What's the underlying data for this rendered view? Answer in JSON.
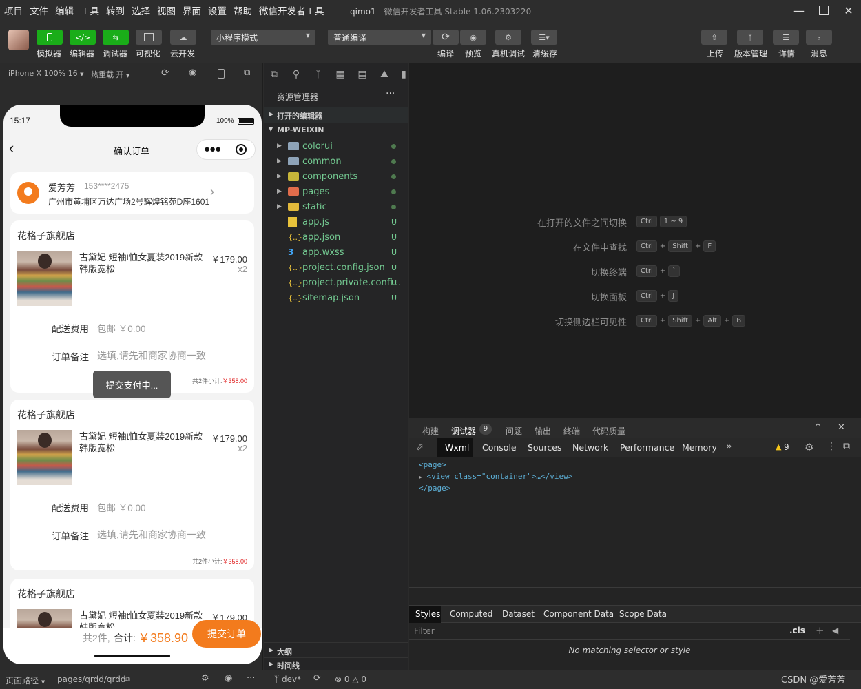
{
  "menubar": {
    "items": [
      "项目",
      "文件",
      "编辑",
      "工具",
      "转到",
      "选择",
      "视图",
      "界面",
      "设置",
      "帮助",
      "微信开发者工具"
    ],
    "app_title": "qimo1",
    "app_subtitle": " - 微信开发者工具 Stable 1.06.2303220"
  },
  "toolbar": {
    "left": [
      {
        "label": "模拟器",
        "icon": "phone-icon",
        "style": "green"
      },
      {
        "label": "编辑器",
        "icon": "code-icon",
        "style": "green"
      },
      {
        "label": "调试器",
        "icon": "swap-icon",
        "style": "green"
      },
      {
        "label": "可视化",
        "icon": "layout-icon",
        "style": "gray"
      },
      {
        "label": "云开发",
        "icon": "cloud-icon",
        "style": "gray"
      }
    ],
    "mode_select": "小程序模式",
    "compile_select": "普通编译",
    "middle": [
      {
        "label": "编译",
        "icon": "refresh-icon"
      },
      {
        "label": "预览",
        "icon": "eye-icon"
      },
      {
        "label": "真机调试",
        "icon": "bug-icon"
      },
      {
        "label": "清缓存",
        "icon": "layers-icon"
      }
    ],
    "right": [
      {
        "label": "上传",
        "icon": "upload-icon"
      },
      {
        "label": "版本管理",
        "icon": "branch-icon"
      },
      {
        "label": "详情",
        "icon": "menu-icon"
      },
      {
        "label": "消息",
        "icon": "bell-icon"
      }
    ]
  },
  "simbar": {
    "device": "iPhone X 100% 16",
    "hotreload": "热重载 开"
  },
  "phone": {
    "time": "15:17",
    "battery": "100%",
    "page_title": "确认订单",
    "address": {
      "name": "爱芳芳",
      "phone": "153****2475",
      "detail": "广州市黄埔区万达广场2号辉煌铭苑D座1601"
    },
    "orders": [
      {
        "store": "花格子旗舰店",
        "product": "古黛妃 短袖t恤女夏装2019新款韩版宽松",
        "price": "￥179.00",
        "qty": "x2",
        "ship_label": "配送费用",
        "ship_value": "包邮 ￥0.00",
        "note_label": "订单备注",
        "note_placeholder": "选填,请先和商家协商一致",
        "subtotal_text": "共2件小计:",
        "subtotal_value": "￥358.00"
      },
      {
        "store": "花格子旗舰店",
        "product": "古黛妃 短袖t恤女夏装2019新款韩版宽松",
        "price": "￥179.00",
        "qty": "x2",
        "ship_label": "配送费用",
        "ship_value": "包邮 ￥0.00",
        "note_label": "订单备注",
        "note_placeholder": "选填,请先和商家协商一致",
        "subtotal_text": "共2件小计:",
        "subtotal_value": "￥358.00"
      },
      {
        "store": "花格子旗舰店",
        "product": "古黛妃 短袖t恤女夏装2019新款韩版宽松",
        "price": "￥179.00"
      }
    ],
    "toast": "提交支付中...",
    "footer": {
      "count": "共2件,",
      "total_label": "合计:",
      "total_value": "￥358.90",
      "submit": "提交订单"
    }
  },
  "explorer": {
    "title": "资源管理器",
    "open_editors": "打开的编辑器",
    "root": "MP-WEIXIN",
    "items": [
      {
        "name": "colorui",
        "type": "folder",
        "status": "dot"
      },
      {
        "name": "common",
        "type": "folder",
        "status": "dot"
      },
      {
        "name": "components",
        "type": "folder-components",
        "status": "dot"
      },
      {
        "name": "pages",
        "type": "folder-pages",
        "status": "dot"
      },
      {
        "name": "static",
        "type": "folder-static",
        "status": "dot"
      },
      {
        "name": "app.js",
        "type": "js",
        "status": "U"
      },
      {
        "name": "app.json",
        "type": "json",
        "status": "U"
      },
      {
        "name": "app.wxss",
        "type": "css",
        "status": "U"
      },
      {
        "name": "project.config.json",
        "type": "json",
        "status": "U"
      },
      {
        "name": "project.private.confi...",
        "type": "json",
        "status": "U"
      },
      {
        "name": "sitemap.json",
        "type": "json",
        "status": "U"
      }
    ],
    "outline": "大纲",
    "timeline": "时间线"
  },
  "editor_hints": [
    {
      "text": "在打开的文件之间切换",
      "keys": [
        "Ctrl",
        "1 ~ 9"
      ]
    },
    {
      "text": "在文件中查找",
      "keys": [
        "Ctrl",
        "Shift",
        "F"
      ]
    },
    {
      "text": "切换终端",
      "keys": [
        "Ctrl",
        "`"
      ]
    },
    {
      "text": "切换面板",
      "keys": [
        "Ctrl",
        "J"
      ]
    },
    {
      "text": "切换侧边栏可见性",
      "keys": [
        "Ctrl",
        "Shift",
        "Alt",
        "B"
      ]
    }
  ],
  "devtools": {
    "top_tabs": [
      "构建",
      "调试器",
      "问题",
      "输出",
      "终端",
      "代码质量"
    ],
    "debugger_badge": "9",
    "tabs": [
      "Wxml",
      "Console",
      "Sources",
      "Network",
      "Performance",
      "Memory"
    ],
    "warnings": "9",
    "wxml_lines": [
      "<page>",
      "<view class=\"container\">…</view>",
      "</page>"
    ],
    "style_tabs": [
      "Styles",
      "Computed",
      "Dataset",
      "Component Data",
      "Scope Data"
    ],
    "filter_placeholder": "Filter",
    "cls": ".cls",
    "no_match": "No matching selector or style"
  },
  "statusbar": {
    "path_label": "页面路径",
    "path": "pages/qrdd/qrdd",
    "branch": "dev*",
    "errors": "0",
    "warnings": "0",
    "watermark": "CSDN @爱芳芳"
  }
}
